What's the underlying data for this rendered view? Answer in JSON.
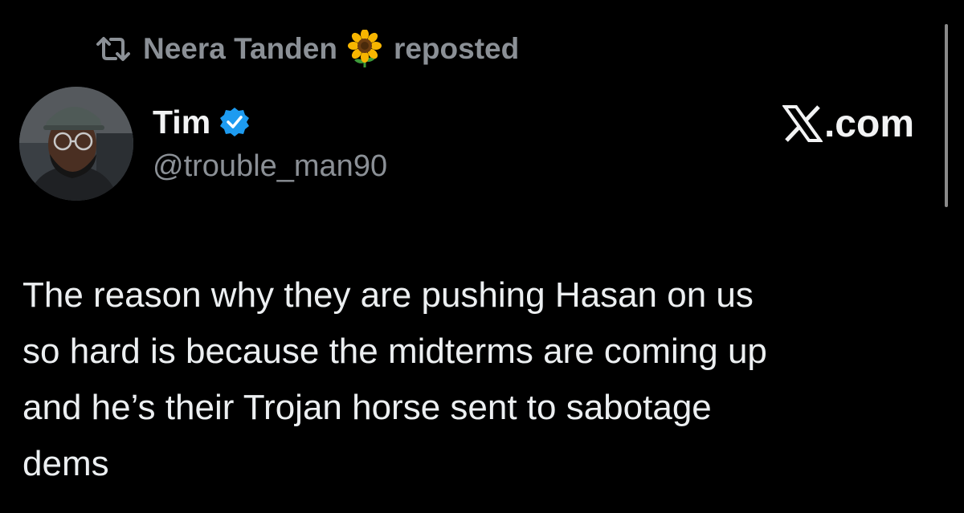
{
  "repost": {
    "icon": "repost-icon",
    "user_name": "Neera Tanden",
    "emoji": "sunflower-icon",
    "action_label": "reposted"
  },
  "author": {
    "display_name": "Tim",
    "verified_icon": "verified-badge-icon",
    "verified_color": "#1d9bf0",
    "handle": "@trouble_man90"
  },
  "brand": {
    "icon": "x-logo-icon",
    "suffix": ".com"
  },
  "tweet": {
    "lines": [
      "The reason why they are pushing Hasan on us",
      "so hard is because the midterms are coming up",
      "and he’s their Trojan horse sent to sabotage",
      "dems"
    ]
  },
  "colors": {
    "background": "#000000",
    "primary_text": "#e7e9ea",
    "secondary_text": "#8b9096"
  }
}
